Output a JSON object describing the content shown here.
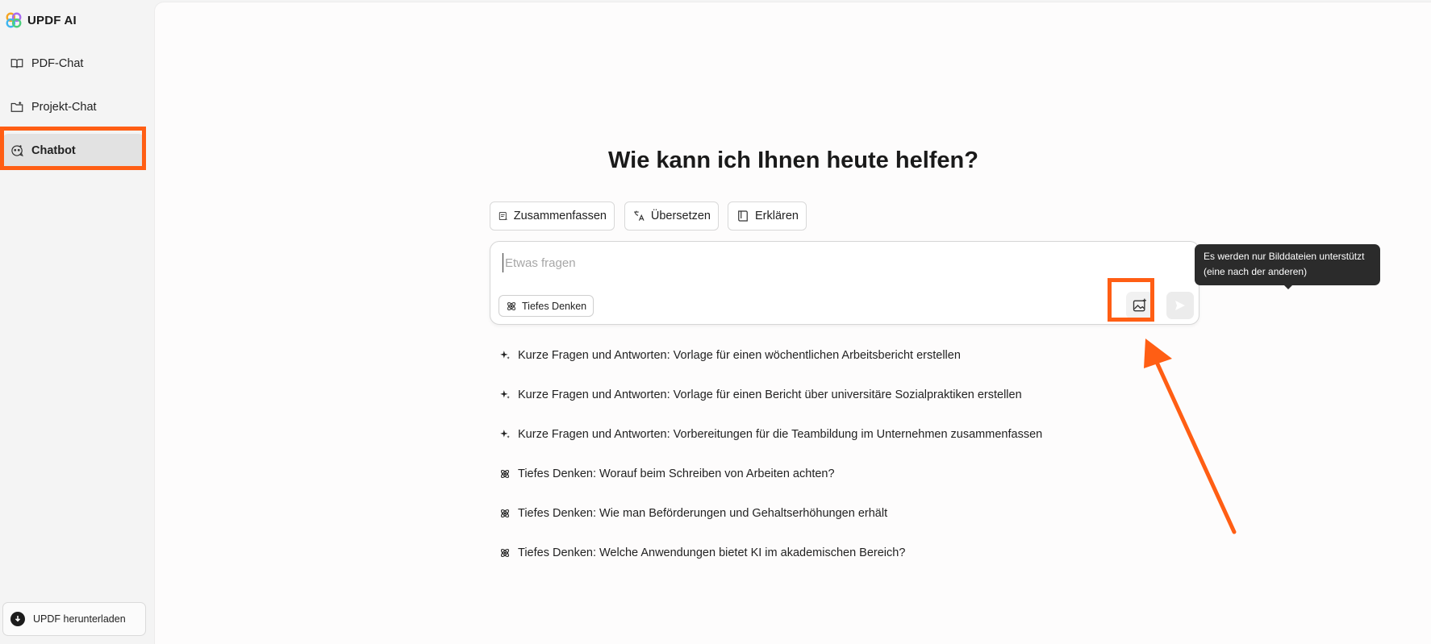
{
  "app": {
    "name": "UPDF AI"
  },
  "sidebar": {
    "items": [
      {
        "label": "PDF-Chat"
      },
      {
        "label": "Projekt-Chat"
      },
      {
        "label": "Chatbot",
        "active": true
      }
    ],
    "download_label": "UPDF herunterladen"
  },
  "main": {
    "headline": "Wie kann ich Ihnen heute helfen?",
    "quick_actions": [
      {
        "label": "Zusammenfassen"
      },
      {
        "label": "Übersetzen"
      },
      {
        "label": "Erklären"
      }
    ],
    "input": {
      "placeholder": "Etwas fragen",
      "value": ""
    },
    "deep_thinking_label": "Tiefes Denken",
    "tooltip": {
      "line1": "Es werden nur Bilddateien unterstützt",
      "line2": "(eine nach der anderen)"
    },
    "suggestions": [
      {
        "icon": "sparkle-icon",
        "text": "Kurze Fragen und Antworten: Vorlage für einen wöchentlichen Arbeitsbericht erstellen"
      },
      {
        "icon": "sparkle-icon",
        "text": "Kurze Fragen und Antworten: Vorlage für einen Bericht über universitäre Sozialpraktiken erstellen"
      },
      {
        "icon": "sparkle-icon",
        "text": "Kurze Fragen und Antworten: Vorbereitungen für die Teambildung im Unternehmen zusammenfassen"
      },
      {
        "icon": "atom-icon",
        "text": "Tiefes Denken: Worauf beim Schreiben von Arbeiten achten?"
      },
      {
        "icon": "atom-icon",
        "text": "Tiefes Denken: Wie man Beförderungen und Gehaltserhöhungen erhält"
      },
      {
        "icon": "atom-icon",
        "text": "Tiefes Denken: Welche Anwendungen bietet KI im akademischen Bereich?"
      }
    ]
  },
  "colors": {
    "highlight": "#ff5e14",
    "sidebar_bg": "#f4f4f4",
    "main_bg": "#fdfcfc",
    "tooltip_bg": "#2b2b2b"
  }
}
